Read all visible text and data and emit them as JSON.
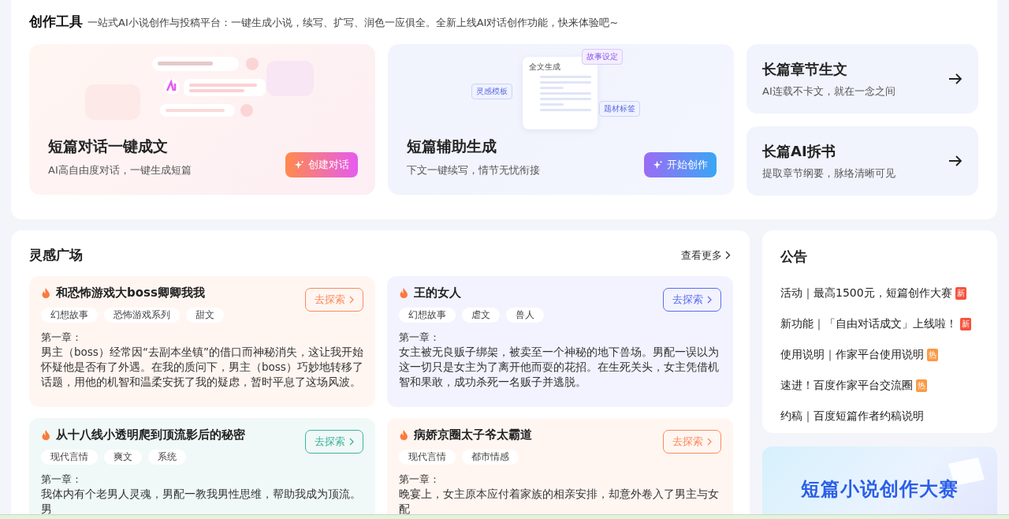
{
  "tools": {
    "title": "创作工具",
    "subtitle": "一站式AI小说创作与投稿平台：一键生成小说，续写、扩写、润色一应俱全。全新上线AI对话创作功能，快来体验吧~",
    "feature_cards": [
      {
        "kind": "dialog",
        "title": "短篇对话一键成文",
        "description": "AI高自由度对话，一键生成短篇",
        "button": "创建对话"
      },
      {
        "kind": "assist",
        "title": "短篇辅助生成",
        "description": "下文一键续写，情节无忧衔接",
        "button": "开始创作",
        "illustration_labels": [
          "全文生成",
          "故事设定",
          "灵感模板",
          "题材标签"
        ]
      }
    ],
    "side_cards": [
      {
        "title": "长篇章节生文",
        "description": "AI连载不卡文，就在一念之间"
      },
      {
        "title": "长篇AI拆书",
        "description": "提取章节纲要，脉络清晰可见"
      }
    ]
  },
  "inspiration": {
    "title": "灵感广场",
    "more_link": "查看更多",
    "cards": [
      {
        "title": "和恐怖游戏大boss卿卿我我",
        "color": "#fb8a5a",
        "tags": [
          "幻想故事",
          "恐怖游戏系列",
          "甜文"
        ],
        "button": "去探索",
        "chapter": "第一章：",
        "excerpt": "男主（boss）经常因“去副本坐镇”的借口而神秘消失，这让我开始怀疑他是否有了外遇。在我的质问下，男主（boss）巧妙地转移了话题，用他的机智和温柔安抚了我的疑虑，暂时平息了这场风波。"
      },
      {
        "title": "王的女人",
        "color": "#5b6cf0",
        "tags": [
          "幻想故事",
          "虐文",
          "兽人"
        ],
        "button": "去探索",
        "chapter": "第一章：",
        "excerpt": "女主被无良贩子绑架，被卖至一个神秘的地下兽场。男配一误以为这一切只是女主为了离开他而耍的花招。在生死关头，女主凭借机智和果敢，成功杀死一名贩子并逃脱。"
      },
      {
        "title": "从十八线小透明爬到顶流影后的秘密",
        "color": "#3bb39a",
        "tags": [
          "现代言情",
          "爽文",
          "系统"
        ],
        "button": "去探索",
        "chapter": "第一章：",
        "excerpt": "我体内有个老男人灵魂，男配一教我男性思维，帮助我成为顶流。男"
      },
      {
        "title": "病娇京圈太子爷太霸道",
        "color": "#fb8a5a",
        "tags": [
          "现代言情",
          "都市情感"
        ],
        "button": "去探索",
        "chapter": "第一章：",
        "excerpt": "晚宴上，女主原本应付着家族的相亲安排，却意外卷入了男主与女配"
      }
    ]
  },
  "announcements": {
    "title": "公告",
    "items": [
      {
        "text": "活动｜最高1500元，短篇创作大赛",
        "badge": "新",
        "kind": "new"
      },
      {
        "text": "新功能｜「自由对话成文」上线啦！",
        "badge": "新",
        "kind": "new"
      },
      {
        "text": "使用说明｜作家平台使用说明",
        "badge": "热",
        "kind": "hot"
      },
      {
        "text": "速进！百度作家平台交流圈",
        "badge": "热",
        "kind": "hot"
      },
      {
        "text": "约稿｜百度短篇作者约稿说明"
      }
    ]
  },
  "banner": {
    "title": "短篇小说创作大赛"
  }
}
